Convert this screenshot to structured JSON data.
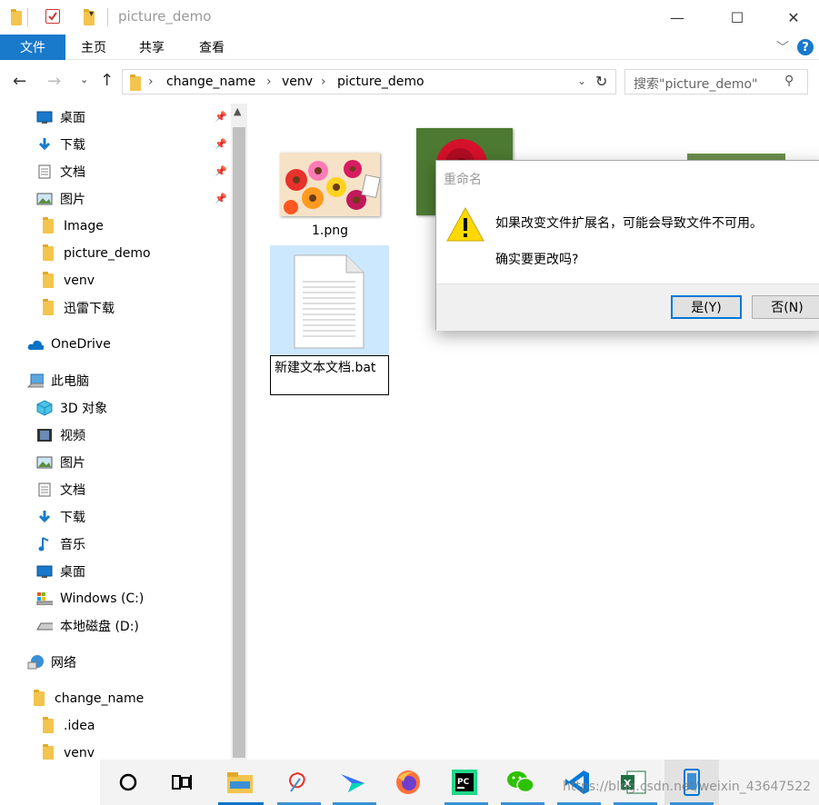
{
  "window": {
    "title": "picture_demo"
  },
  "ribbon": {
    "tabs": [
      "文件",
      "主页",
      "共享",
      "查看"
    ]
  },
  "address": {
    "segments": [
      "change_name",
      "venv",
      "picture_demo"
    ],
    "search_placeholder": "搜索\"picture_demo\""
  },
  "nav": {
    "quick_access": [
      {
        "label": "桌面",
        "icon": "desktop-icon",
        "pinned": true
      },
      {
        "label": "下载",
        "icon": "download-icon",
        "pinned": true
      },
      {
        "label": "文档",
        "icon": "document-icon",
        "pinned": true
      },
      {
        "label": "图片",
        "icon": "picture-icon",
        "pinned": true
      },
      {
        "label": "Image",
        "icon": "folder-icon",
        "pinned": false
      },
      {
        "label": "picture_demo",
        "icon": "folder-icon",
        "pinned": false
      },
      {
        "label": "venv",
        "icon": "folder-icon",
        "pinned": false
      },
      {
        "label": "迅雷下载",
        "icon": "folder-icon",
        "pinned": false
      }
    ],
    "onedrive": "OneDrive",
    "this_pc": "此电脑",
    "pc_items": [
      {
        "label": "3D 对象",
        "icon": "3d-objects-icon"
      },
      {
        "label": "视频",
        "icon": "video-icon"
      },
      {
        "label": "图片",
        "icon": "picture-icon"
      },
      {
        "label": "文档",
        "icon": "document-icon"
      },
      {
        "label": "下载",
        "icon": "download-icon"
      },
      {
        "label": "音乐",
        "icon": "music-icon"
      },
      {
        "label": "桌面",
        "icon": "desktop-icon"
      },
      {
        "label": "Windows (C:)",
        "icon": "drive-c-icon"
      },
      {
        "label": "本地磁盘 (D:)",
        "icon": "drive-d-icon"
      }
    ],
    "network": "网络",
    "project_root": "change_name",
    "project_children": [
      ".idea",
      "venv"
    ]
  },
  "files": [
    {
      "name": "1.png",
      "kind": "image-flowers"
    },
    {
      "name": "新建文本文档.bat",
      "kind": "text-file"
    }
  ],
  "dialog": {
    "title": "重命名",
    "message": "如果改变文件扩展名，可能会导致文件不可用。",
    "question": "确实要更改吗?",
    "yes": "是(Y)",
    "no": "否(N)"
  },
  "taskbar": {
    "watermark": "https://blog.csdn.net/weixin_43647522",
    "apps": [
      "cortana-icon",
      "task-view-icon",
      "file-explorer-icon",
      "photos-app-icon",
      "feishu-icon",
      "firefox-icon",
      "pycharm-icon",
      "wechat-icon",
      "vscode-icon",
      "excel-icon",
      "phone-app-icon"
    ]
  },
  "colors": {
    "accent": "#0a72c7",
    "selection": "#cce8ff",
    "warning": "#ffd800"
  }
}
